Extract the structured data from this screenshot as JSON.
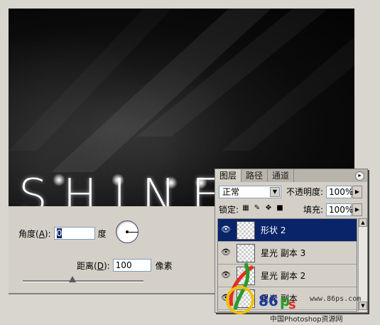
{
  "canvas": {
    "artwork_text": "SHINE"
  },
  "dialog": {
    "angle_label": "角度(",
    "angle_key": "A",
    "angle_suffix": "):",
    "angle_value": "0",
    "angle_unit": "度",
    "distance_label": "距离(",
    "distance_key": "D",
    "distance_suffix": "):",
    "distance_value": "100",
    "distance_unit": "像素"
  },
  "layers_panel": {
    "tabs": [
      "图层",
      "路径",
      "通道"
    ],
    "blend_mode": "正常",
    "opacity_label": "不透明度:",
    "opacity_value": "100%",
    "lock_label": "锁定:",
    "fill_label": "填充:",
    "fill_value": "100%",
    "layers": [
      {
        "name": "形状 2",
        "selected": true
      },
      {
        "name": "星光 副本 3",
        "selected": false
      },
      {
        "name": "星光 副本 2",
        "selected": false
      },
      {
        "name": "星光 副本",
        "selected": false
      }
    ]
  },
  "watermark": {
    "url": "www.86ps.com",
    "caption": "中国Photoshop资源网"
  },
  "colors": {
    "selection": "#0a246a",
    "panel_bg": "#d4d0c8",
    "canvas_bg": "#050505"
  }
}
